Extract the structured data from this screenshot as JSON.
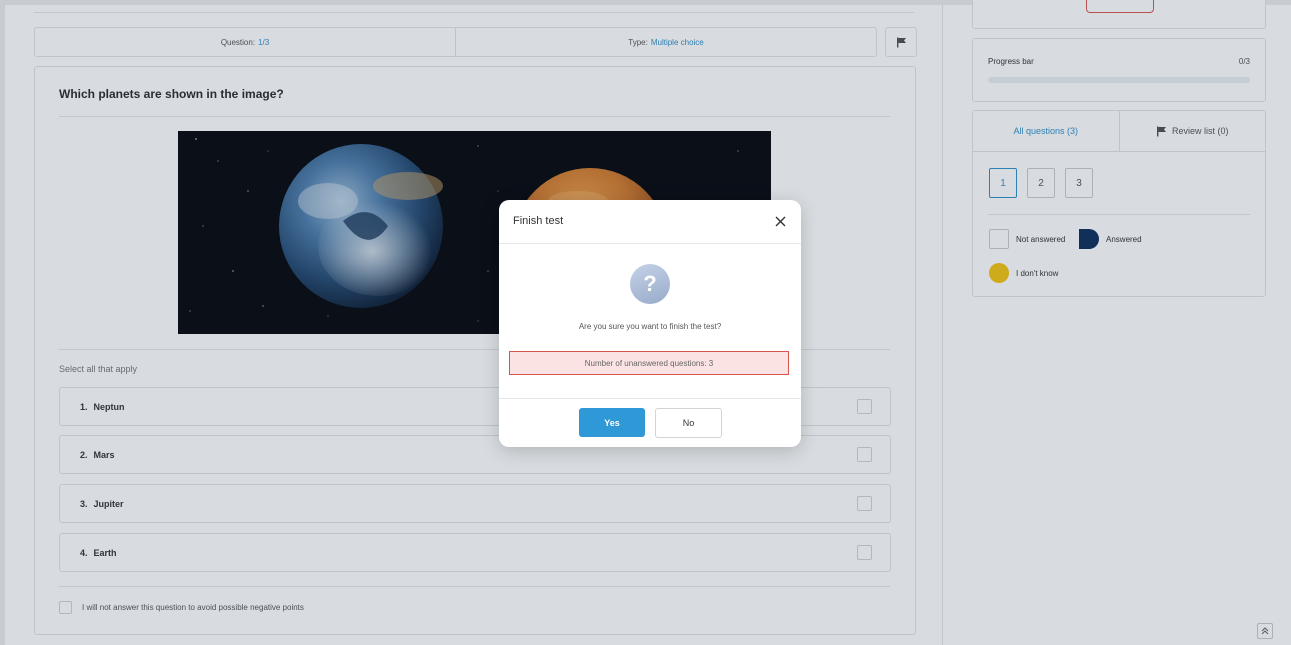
{
  "info_bar": {
    "question_label": "Question:",
    "question_value": "1/3",
    "type_label": "Type:",
    "type_value": "Multiple choice"
  },
  "question": {
    "title": "Which planets are shown in the image?",
    "instruction": "Select all that apply",
    "options": [
      {
        "number": "1.",
        "label": "Neptun"
      },
      {
        "number": "2.",
        "label": "Mars"
      },
      {
        "number": "3.",
        "label": "Jupiter"
      },
      {
        "number": "4.",
        "label": "Earth"
      }
    ],
    "no_answer_label": "I will not answer this question to avoid possible negative points"
  },
  "sidebar": {
    "progress": {
      "title": "Progress bar",
      "count": "0/3",
      "fraction": 0
    },
    "tabs": {
      "all": "All questions (3)",
      "review": "Review list (0)"
    },
    "question_numbers": [
      "1",
      "2",
      "3"
    ],
    "legend": {
      "not_answered": "Not answered",
      "answered": "Answered",
      "dont_know": "I don't know"
    }
  },
  "modal": {
    "title": "Finish test",
    "icon_glyph": "?",
    "message": "Are you sure you want to finish the test?",
    "unanswered": "Number of unanswered questions: 3",
    "yes_label": "Yes",
    "no_label": "No"
  },
  "colors": {
    "accent": "#2f98d6",
    "answered": "#0b2e5c",
    "dont_know": "#f2c40f",
    "warning_border": "#d9534f",
    "warning_bg": "#fbe3e3"
  }
}
